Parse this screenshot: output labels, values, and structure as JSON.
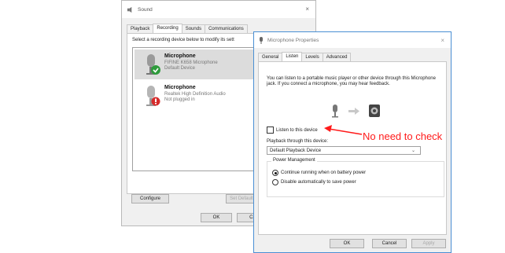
{
  "sound_dialog": {
    "title": "Sound",
    "close": "×",
    "tabs": [
      "Playback",
      "Recording",
      "Sounds",
      "Communications"
    ],
    "active_tab": "Recording",
    "instruction": "Select a recording device below to modify its sett",
    "devices": [
      {
        "name": "Microphone",
        "detail": "FIFINE K658 Microphone",
        "status": "Default Device",
        "status_icon": "check-icon"
      },
      {
        "name": "Microphone",
        "detail": "Realtek High Definition Audio",
        "status": "Not plugged in",
        "status_icon": "unplugged-icon"
      }
    ],
    "configure_label": "Configure",
    "set_default_label": "Set Default",
    "ok_label": "OK",
    "cancel_label": "Ca"
  },
  "properties_dialog": {
    "title": "Microphone Properties",
    "close": "×",
    "tabs": [
      "General",
      "Listen",
      "Levels",
      "Advanced"
    ],
    "active_tab": "Listen",
    "description": "You can listen to a portable music player or other device through this Microphone jack.  If you connect a microphone, you may hear feedback.",
    "listen_checkbox_label": "Listen to this device",
    "listen_checked": false,
    "playback_label": "Playback through this device:",
    "playback_value": "Default Playback Device",
    "power_title": "Power Management",
    "power_options": [
      {
        "label": "Continue running when on battery power",
        "selected": true
      },
      {
        "label": "Disable automatically to save power",
        "selected": false
      }
    ],
    "ok_label": "OK",
    "cancel_label": "Cancel",
    "apply_label": "Apply"
  },
  "annotation": {
    "text": "No need to check",
    "color": "#ff1a1a"
  }
}
